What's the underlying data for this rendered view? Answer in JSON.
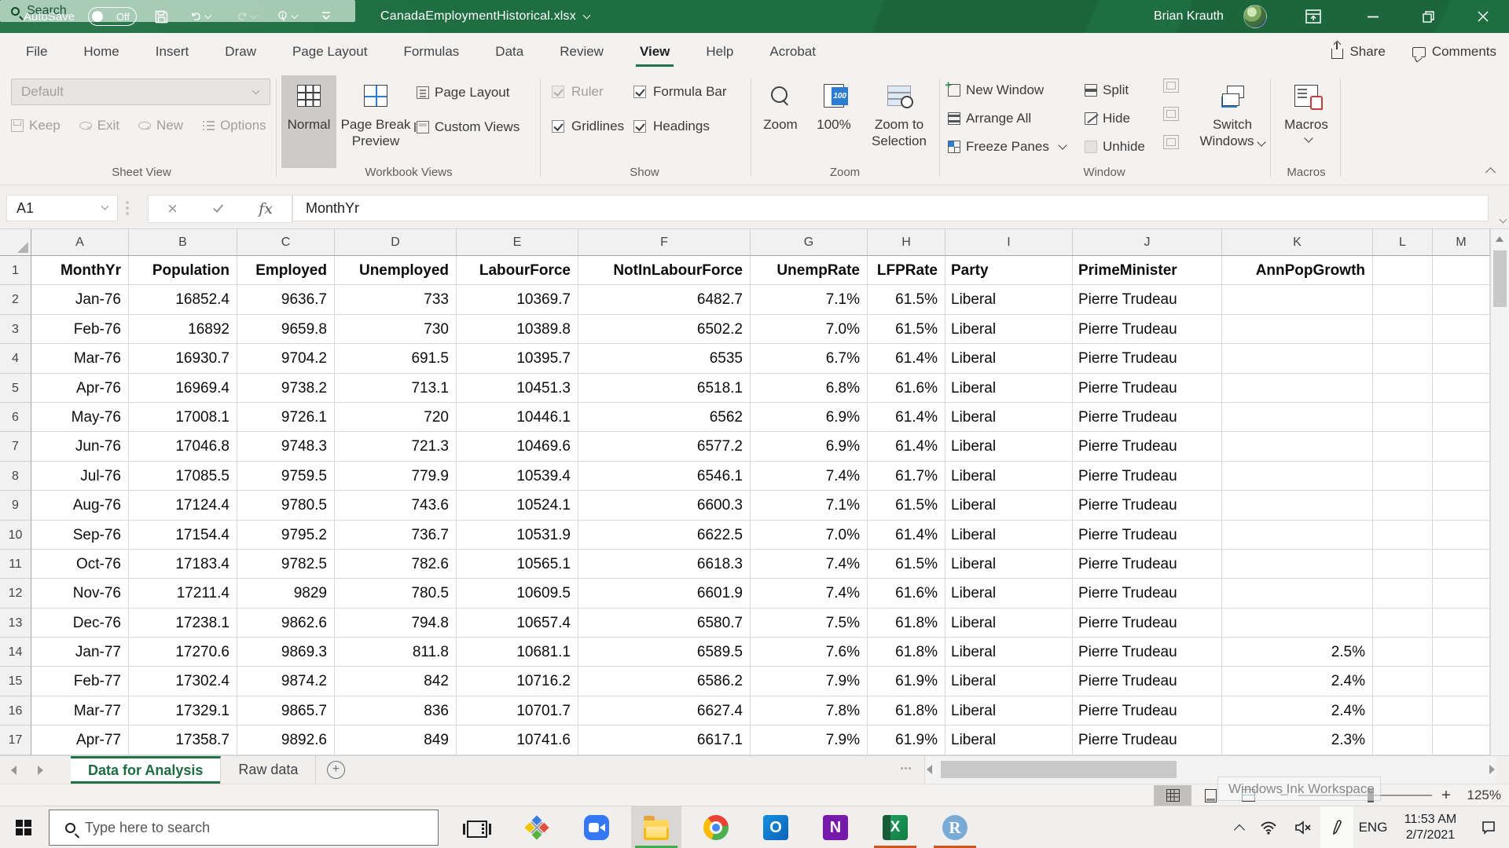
{
  "titlebar": {
    "autosave_label": "AutoSave",
    "autosave_state": "Off",
    "filename": "CanadaEmploymentHistorical.xlsx",
    "search_placeholder": "Search",
    "user_name": "Brian Krauth"
  },
  "ribbon_tabs": [
    {
      "label": "File"
    },
    {
      "label": "Home"
    },
    {
      "label": "Insert"
    },
    {
      "label": "Draw"
    },
    {
      "label": "Page Layout"
    },
    {
      "label": "Formulas"
    },
    {
      "label": "Data"
    },
    {
      "label": "Review"
    },
    {
      "label": "View",
      "active": true
    },
    {
      "label": "Help"
    },
    {
      "label": "Acrobat"
    }
  ],
  "tabrow_right": {
    "share": "Share",
    "comments": "Comments"
  },
  "ribbon": {
    "sheet_view": {
      "group_label": "Sheet View",
      "default_view": "Default",
      "keep": "Keep",
      "exit": "Exit",
      "new": "New",
      "options": "Options"
    },
    "workbook_views": {
      "group_label": "Workbook Views",
      "normal": "Normal",
      "page_break_preview": "Page Break Preview",
      "page_layout": "Page Layout",
      "custom_views": "Custom Views"
    },
    "show": {
      "group_label": "Show",
      "items": [
        {
          "label": "Ruler",
          "checked": true,
          "disabled": true
        },
        {
          "label": "Gridlines",
          "checked": true,
          "disabled": false
        },
        {
          "label": "Formula Bar",
          "checked": true,
          "disabled": false
        },
        {
          "label": "Headings",
          "checked": true,
          "disabled": false
        }
      ]
    },
    "zoom": {
      "group_label": "Zoom",
      "zoom": "Zoom",
      "hundred_percent": "100%",
      "zoom_to_selection": "Zoom to Selection"
    },
    "window": {
      "group_label": "Window",
      "new_window": "New Window",
      "arrange_all": "Arrange All",
      "freeze_panes": "Freeze Panes",
      "split": "Split",
      "hide": "Hide",
      "unhide": "Unhide",
      "switch_windows_line1": "Switch",
      "switch_windows_line2": "Windows"
    },
    "macros": {
      "group_label": "Macros",
      "button": "Macros"
    }
  },
  "formula_bar": {
    "name_box": "A1",
    "formula": "MonthYr"
  },
  "sheet": {
    "columns": [
      "A",
      "B",
      "C",
      "D",
      "E",
      "F",
      "G",
      "H",
      "I",
      "J",
      "K",
      "L",
      "M"
    ],
    "header_row": [
      "MonthYr",
      "Population",
      "Employed",
      "Unemployed",
      "LabourForce",
      "NotInLabourForce",
      "UnempRate",
      "LFPRate",
      "Party",
      "PrimeMinister",
      "AnnPopGrowth",
      "",
      ""
    ],
    "rows": [
      [
        "Jan-76",
        "16852.4",
        "9636.7",
        "733",
        "10369.7",
        "6482.7",
        "7.1%",
        "61.5%",
        "Liberal",
        "Pierre Trudeau",
        ""
      ],
      [
        "Feb-76",
        "16892",
        "9659.8",
        "730",
        "10389.8",
        "6502.2",
        "7.0%",
        "61.5%",
        "Liberal",
        "Pierre Trudeau",
        ""
      ],
      [
        "Mar-76",
        "16930.7",
        "9704.2",
        "691.5",
        "10395.7",
        "6535",
        "6.7%",
        "61.4%",
        "Liberal",
        "Pierre Trudeau",
        ""
      ],
      [
        "Apr-76",
        "16969.4",
        "9738.2",
        "713.1",
        "10451.3",
        "6518.1",
        "6.8%",
        "61.6%",
        "Liberal",
        "Pierre Trudeau",
        ""
      ],
      [
        "May-76",
        "17008.1",
        "9726.1",
        "720",
        "10446.1",
        "6562",
        "6.9%",
        "61.4%",
        "Liberal",
        "Pierre Trudeau",
        ""
      ],
      [
        "Jun-76",
        "17046.8",
        "9748.3",
        "721.3",
        "10469.6",
        "6577.2",
        "6.9%",
        "61.4%",
        "Liberal",
        "Pierre Trudeau",
        ""
      ],
      [
        "Jul-76",
        "17085.5",
        "9759.5",
        "779.9",
        "10539.4",
        "6546.1",
        "7.4%",
        "61.7%",
        "Liberal",
        "Pierre Trudeau",
        ""
      ],
      [
        "Aug-76",
        "17124.4",
        "9780.5",
        "743.6",
        "10524.1",
        "6600.3",
        "7.1%",
        "61.5%",
        "Liberal",
        "Pierre Trudeau",
        ""
      ],
      [
        "Sep-76",
        "17154.4",
        "9795.2",
        "736.7",
        "10531.9",
        "6622.5",
        "7.0%",
        "61.4%",
        "Liberal",
        "Pierre Trudeau",
        ""
      ],
      [
        "Oct-76",
        "17183.4",
        "9782.5",
        "782.6",
        "10565.1",
        "6618.3",
        "7.4%",
        "61.5%",
        "Liberal",
        "Pierre Trudeau",
        ""
      ],
      [
        "Nov-76",
        "17211.4",
        "9829",
        "780.5",
        "10609.5",
        "6601.9",
        "7.4%",
        "61.6%",
        "Liberal",
        "Pierre Trudeau",
        ""
      ],
      [
        "Dec-76",
        "17238.1",
        "9862.6",
        "794.8",
        "10657.4",
        "6580.7",
        "7.5%",
        "61.8%",
        "Liberal",
        "Pierre Trudeau",
        ""
      ],
      [
        "Jan-77",
        "17270.6",
        "9869.3",
        "811.8",
        "10681.1",
        "6589.5",
        "7.6%",
        "61.8%",
        "Liberal",
        "Pierre Trudeau",
        "2.5%"
      ],
      [
        "Feb-77",
        "17302.4",
        "9874.2",
        "842",
        "10716.2",
        "6586.2",
        "7.9%",
        "61.9%",
        "Liberal",
        "Pierre Trudeau",
        "2.4%"
      ],
      [
        "Mar-77",
        "17329.1",
        "9865.7",
        "836",
        "10701.7",
        "6627.4",
        "7.8%",
        "61.8%",
        "Liberal",
        "Pierre Trudeau",
        "2.4%"
      ],
      [
        "Apr-77",
        "17358.7",
        "9892.6",
        "849",
        "10741.6",
        "6617.1",
        "7.9%",
        "61.9%",
        "Liberal",
        "Pierre Trudeau",
        "2.3%"
      ]
    ]
  },
  "sheet_tabs": {
    "tabs": [
      {
        "label": "Data for Analysis",
        "active": true
      },
      {
        "label": "Raw data",
        "active": false
      }
    ]
  },
  "status_bar": {
    "zoom_level": "125%",
    "tooltip_ghost": "Windows Ink Workspace"
  },
  "taskbar": {
    "search_placeholder": "Type here to search",
    "apps": [
      {
        "name": "task-view"
      },
      {
        "name": "snip-diamond"
      },
      {
        "name": "zoom-app"
      },
      {
        "name": "file-explorer",
        "active": true,
        "indicator": "green"
      },
      {
        "name": "chrome"
      },
      {
        "name": "outlook"
      },
      {
        "name": "onenote"
      },
      {
        "name": "excel",
        "indicator": "orange"
      },
      {
        "name": "rstudio",
        "indicator": "orange"
      }
    ],
    "language": "ENG",
    "time": "11:53 AM",
    "date": "2/7/2021"
  },
  "colors": {
    "excel_green": "#217346",
    "titlebar_green": "#1e6e42",
    "search_pill_green": "#a3c9b1",
    "running_indicator_green": "#3fae49",
    "running_indicator_orange": "#d0541e",
    "freeze_accent_blue": "#2b7cd3",
    "macro_scroll_red": "#c43e3e"
  }
}
